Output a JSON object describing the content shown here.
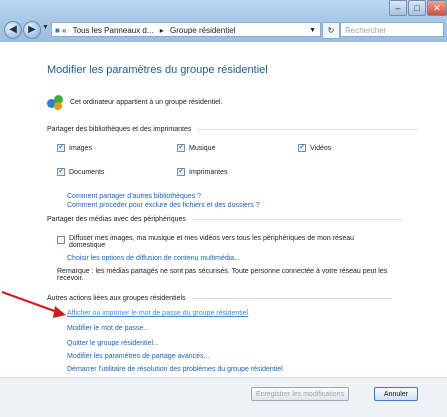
{
  "window": {
    "controls": {
      "minimize": "–",
      "maximize": "□",
      "close": "✕"
    }
  },
  "nav": {
    "back_glyph": "◀",
    "forward_glyph": "▶",
    "breadcrumb": [
      "Tous les Panneaux d...",
      "Groupe résidentiel"
    ],
    "breadcrumb_sep": "▸",
    "refresh_glyph": "↻",
    "search_placeholder": "Rechercher"
  },
  "page": {
    "title": "Modifier les paramètres du groupe résidentiel",
    "intro": "Cet ordinateur appartient à un groupe résidentiel.",
    "libraries_section": "Partager des bibliothèques et des imprimantes",
    "libraries": [
      {
        "label": "Images",
        "checked": true
      },
      {
        "label": "Musique",
        "checked": true
      },
      {
        "label": "Vidéos",
        "checked": true
      },
      {
        "label": "Documents",
        "checked": true
      },
      {
        "label": "Imprimantes",
        "checked": true
      }
    ],
    "link_share_other": "Comment partager d'autres bibliothèques ?",
    "link_exclude": "Comment procéder pour exclure des fichiers et des dossiers ?",
    "media_section": "Partager des médias avec des périphériques",
    "media_checkbox_line1": "Diffuser mes images, ma musique et mes vidéos vers tous les périphériques de mon réseau",
    "media_checkbox_line2": "domestique",
    "media_checked": false,
    "link_media_options": "Choisir les options de diffusion de contenu multimédia...",
    "note_line1": "Remarque : les médias partagés ne sont pas sécurisés. Toute personne connectée à votre réseau peut les",
    "note_line2": "recevoir.",
    "other_section": "Autres actions liées aux groupes résidentiels",
    "actions": [
      "Afficher ou imprimer le mot de passe du groupe résidentiel",
      "Modifier le mot de passe...",
      "Quitter le groupe résidentiel...",
      "Modifier les paramètres de partage avancés...",
      "Démarrer l'utilitaire de résolution des problèmes du groupe résidentiel"
    ]
  },
  "footer": {
    "save": "Enregistrer les modifications",
    "cancel": "Annuler"
  },
  "colors": {
    "accent": "#1a63b8",
    "arrow": "#d01c1c",
    "title": "#1f5c8a"
  }
}
